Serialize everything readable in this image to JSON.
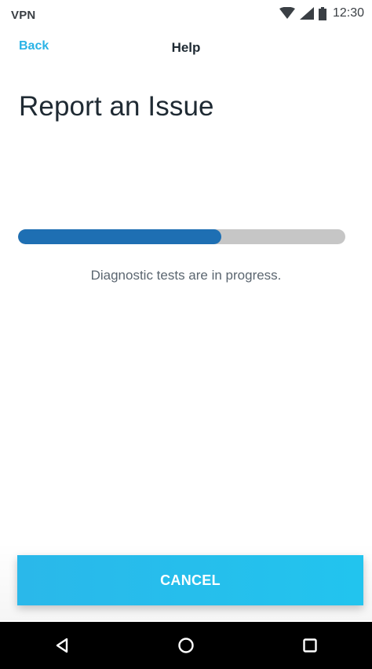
{
  "status_bar": {
    "left_label": "VPN",
    "time": "12:30",
    "icons": [
      "wifi-icon",
      "cellular-signal-icon",
      "battery-icon"
    ]
  },
  "header": {
    "back_label": "Back",
    "title": "Help"
  },
  "page": {
    "title": "Report an Issue"
  },
  "progress": {
    "fraction": 0.62,
    "caption": "Diagnostic tests are in progress."
  },
  "actions": {
    "cancel_label": "CANCEL"
  },
  "system_nav": {
    "buttons": [
      "back-triangle-icon",
      "home-circle-icon",
      "recents-square-icon"
    ]
  },
  "colors": {
    "accent": "#2ab3e6",
    "progress_fill": "#1e6fb3",
    "progress_track": "#c6c6c6",
    "button": "#22c4ee"
  }
}
